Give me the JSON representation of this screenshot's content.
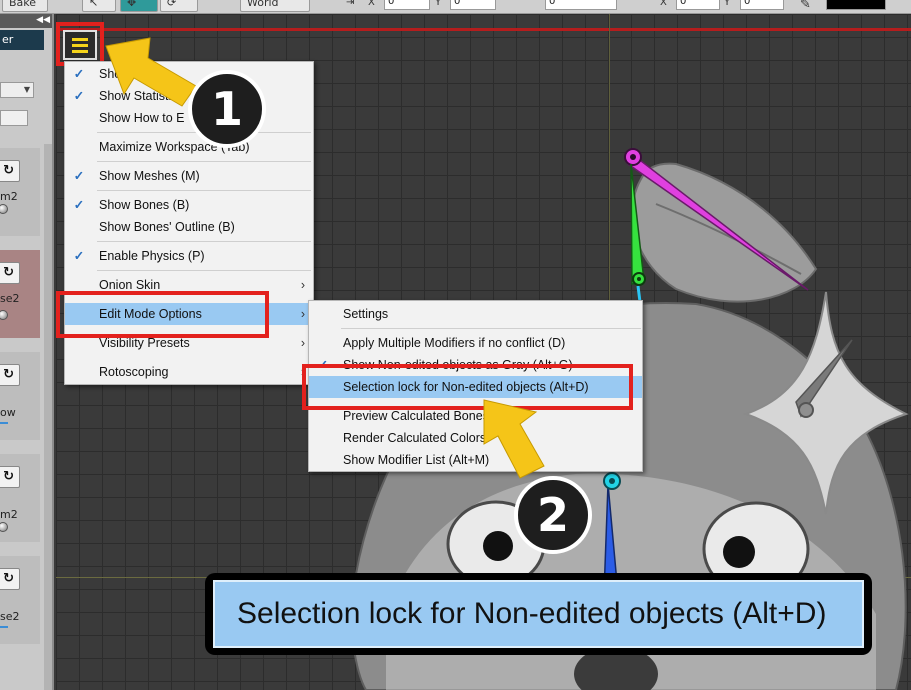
{
  "toolbar": {
    "bake_label": "Bake",
    "space_value": "World",
    "x_label": "X",
    "y_label": "Y",
    "x_value": "0",
    "y_value": "0",
    "rot_value": "0",
    "x2_value": "0",
    "y2_value": "0"
  },
  "left_panel": {
    "name_field": "er",
    "cards": [
      {
        "label": "m2"
      },
      {
        "label": "se2"
      },
      {
        "label": "ow"
      },
      {
        "label": "m2"
      },
      {
        "label": "se2"
      }
    ]
  },
  "main_menu": {
    "items": [
      {
        "label": "Show ",
        "checked": true
      },
      {
        "label": "Show Statistics",
        "checked": true
      },
      {
        "label": "Show How to E",
        "checked": false
      },
      {
        "label": "Maximize Workspace (Tab)",
        "checked": false
      },
      {
        "label": "Show Meshes (M)",
        "checked": true
      },
      {
        "label": "Show Bones (B)",
        "checked": true
      },
      {
        "label": "Show Bones' Outline (B)",
        "checked": false
      },
      {
        "label": "Enable Physics (P)",
        "checked": true
      },
      {
        "label": "Onion Skin",
        "checked": false,
        "submenu": true
      },
      {
        "label": "Edit Mode Options",
        "checked": false,
        "submenu": true,
        "selected": true
      },
      {
        "label": "Visibility Presets",
        "checked": false,
        "submenu": true
      },
      {
        "label": "Rotoscoping",
        "checked": false,
        "submenu": true
      }
    ]
  },
  "sub_menu": {
    "items": [
      {
        "label": "Settings",
        "checked": false
      },
      {
        "label": "Apply Multiple Modifiers if no conflict (D)",
        "checked": false
      },
      {
        "label": "Show Non-edited objects as Gray (Alt+G)",
        "checked": true
      },
      {
        "label": "Selection lock for Non-edited objects (Alt+D)",
        "checked": false,
        "selected": true
      },
      {
        "label": "Preview Calculated Bones",
        "checked": false
      },
      {
        "label": "Render Calculated Colors",
        "checked": false
      },
      {
        "label": "Show Modifier List (Alt+M)",
        "checked": false
      }
    ]
  },
  "callouts": {
    "step1": "1",
    "step2": "2"
  },
  "zoom_caption": "Selection lock for Non-edited objects (Alt+D)",
  "colors": {
    "highlight": "#e3211d",
    "arrow": "#f5c518",
    "selection": "#99c9f2",
    "menu_icon": "#f4d31a",
    "bone_magenta": "#e040e0",
    "bone_green": "#36e23e",
    "bone_blue": "#2b5ce6"
  }
}
